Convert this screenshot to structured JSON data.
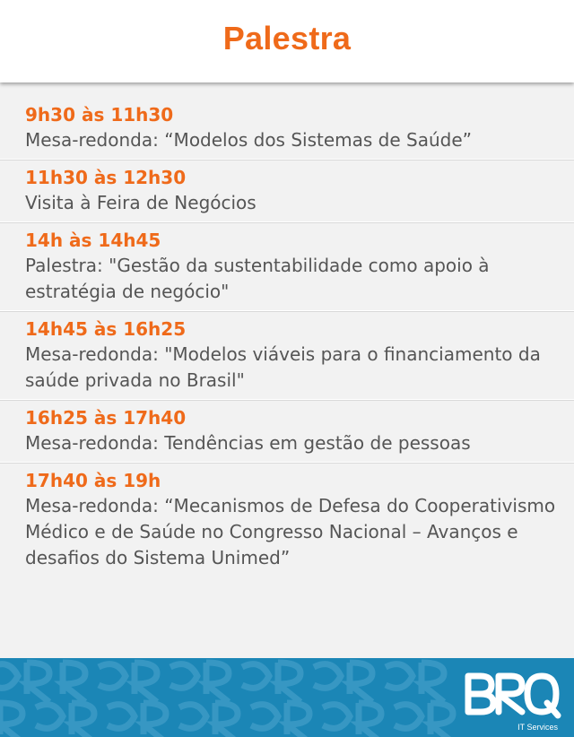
{
  "header": {
    "title": "Palestra"
  },
  "schedule": [
    {
      "time": "9h30 às 11h30",
      "description": "Mesa-redonda: “Modelos dos Sistemas de Saúde”"
    },
    {
      "time": "11h30 às 12h30",
      "description": "Visita à Feira de Negócios"
    },
    {
      "time": "14h às 14h45",
      "description": "Palestra: \"Gestão da sustentabilidade como apoio à estratégia de negócio\""
    },
    {
      "time": "14h45 às 16h25",
      "description": "Mesa-redonda: \"Modelos viáveis para o financiamento da saúde privada no Brasil\""
    },
    {
      "time": "16h25 às 17h40",
      "description": "Mesa-redonda: Tendências em gestão de pessoas"
    },
    {
      "time": "17h40 às 19h",
      "description": "Mesa-redonda: “Mecanismos de Defesa do Cooperativismo Médico e de Saúde no Congresso Nacional – Avanços e desafios do Sistema Unimed”"
    }
  ],
  "footer": {
    "logo_text": "BRQ",
    "logo_subtext": "IT Services",
    "background_color": "#1b86b6",
    "accent_color": "#ef6a1a"
  }
}
